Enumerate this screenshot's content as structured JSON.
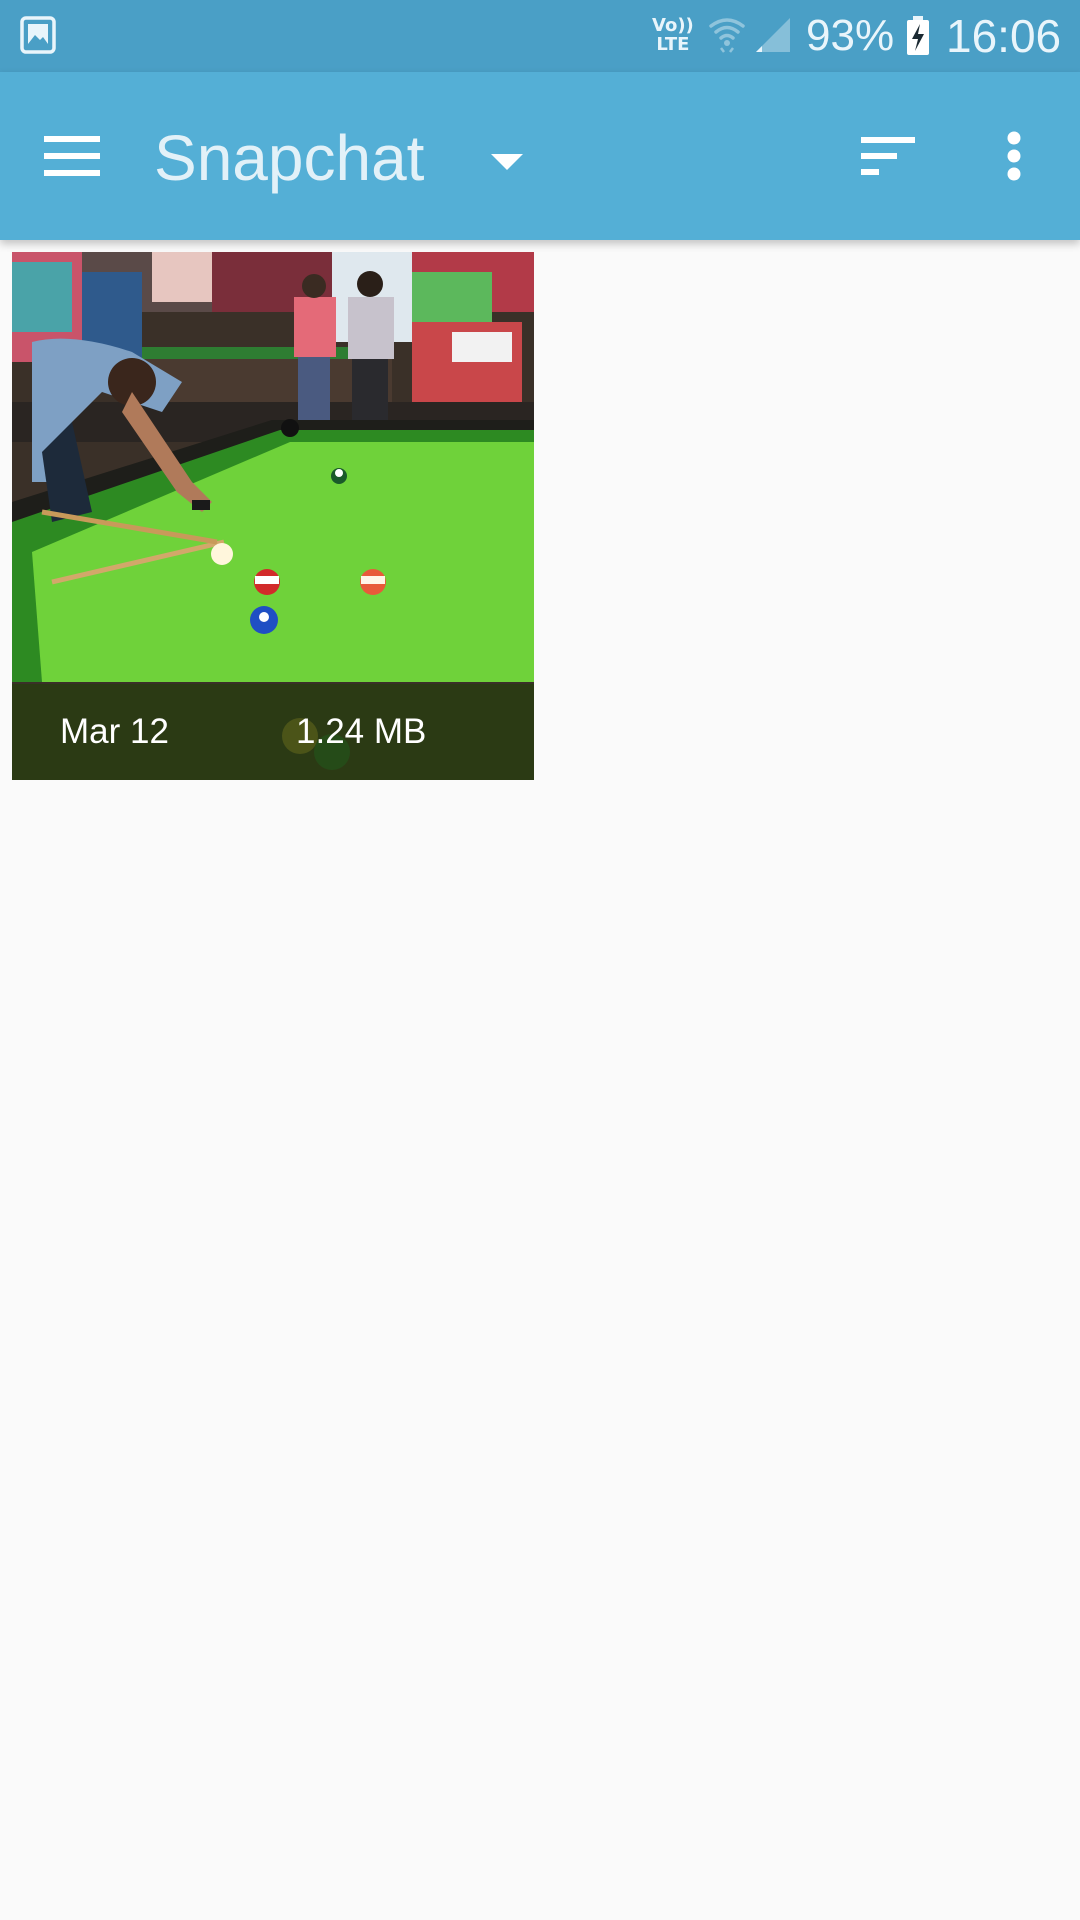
{
  "status_bar": {
    "volte_line1": "Vo))",
    "volte_line2": "LTE",
    "battery_percent": "93%",
    "time": "16:06",
    "icons": [
      "gallery-icon",
      "volte-icon",
      "wifi-icon",
      "signal-icon",
      "battery-charging-icon"
    ]
  },
  "toolbar": {
    "title": "Snapchat",
    "icons": [
      "menu-icon",
      "dropdown-arrow-icon",
      "sort-icon",
      "more-options-icon"
    ]
  },
  "items": [
    {
      "date": "Mar 12",
      "size": "1.24 MB"
    }
  ],
  "colors": {
    "status_bar": "#4a9fc6",
    "toolbar": "#54afd6",
    "background": "#fafafa",
    "tile_footer": "#2f4a12"
  }
}
